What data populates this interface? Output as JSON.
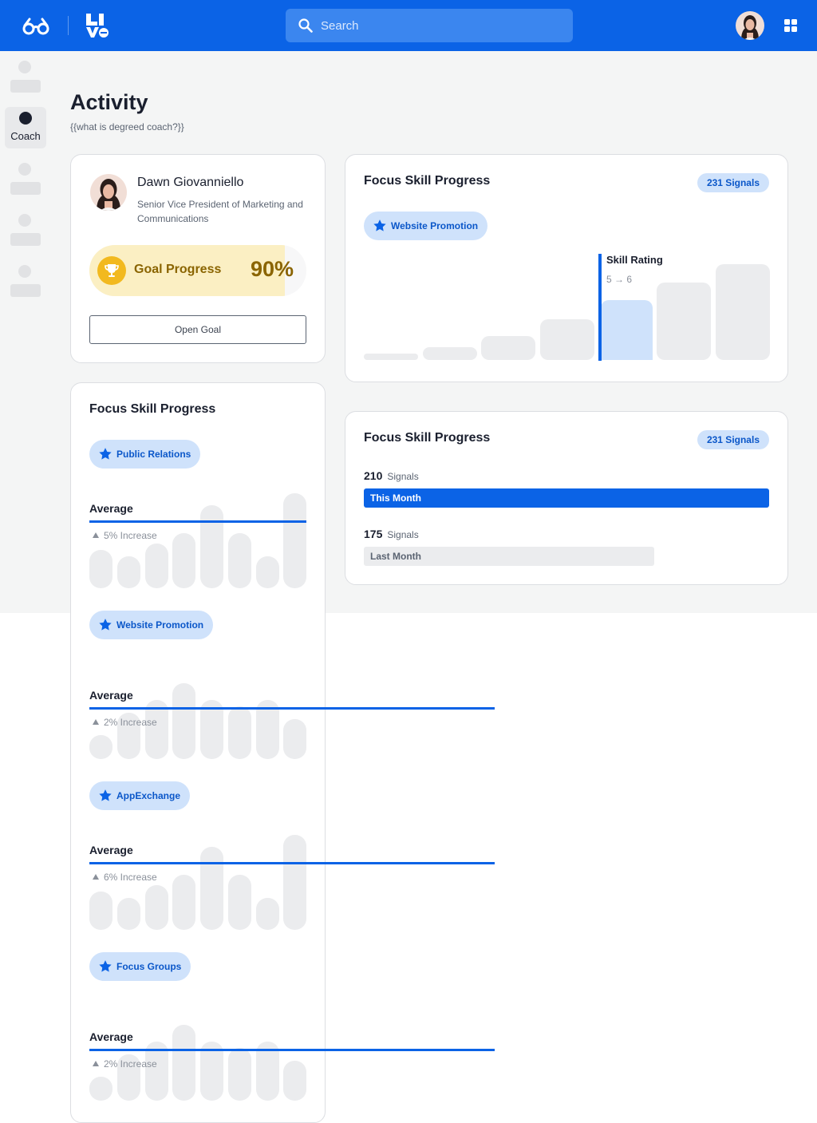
{
  "topbar": {
    "search_placeholder": "Search"
  },
  "sidebar": {
    "active_label": "Coach"
  },
  "page": {
    "title": "Activity",
    "subtitle": "{{what is degreed coach?}}"
  },
  "profile": {
    "name": "Dawn Giovanniello",
    "role": "Senior Vice President of Marketing and Communications",
    "goal_label": "Goal Progress",
    "goal_value": "90%",
    "goal_fraction": 0.9,
    "open_goal_label": "Open Goal"
  },
  "skill_card": {
    "title": "Focus Skill Progress",
    "badge": "231 Signals",
    "skill": "Website Promotion",
    "rating_label": "Skill Rating",
    "rating_value": "5 → 6"
  },
  "signals_card": {
    "title": "Focus Skill Progress",
    "badge": "231 Signals",
    "this_month_value": "210",
    "this_month_word": "Signals",
    "this_month_label": "This Month",
    "last_month_value": "175",
    "last_month_word": "Signals",
    "last_month_label": "Last Month"
  },
  "list_card": {
    "title": "Focus Skill Progress",
    "skills": [
      {
        "name": "Public Relations",
        "average_label": "Average",
        "increase": "5% Increase"
      },
      {
        "name": "Website Promotion",
        "average_label": "Average",
        "increase": "2% Increase"
      },
      {
        "name": "AppExchange",
        "average_label": "Average",
        "increase": "6% Increase"
      },
      {
        "name": "Focus Groups",
        "average_label": "Average",
        "increase": "2% Increase"
      }
    ]
  },
  "colors": {
    "brand": "#0b63e6",
    "badge_bg": "#cfe2fb",
    "goal_fill": "#fbefc3",
    "goal_text": "#8a6400",
    "trophy": "#f2b91f"
  },
  "icons": [
    "glasses-logo-icon",
    "lve-logo-icon",
    "search-icon",
    "apps-grid-icon",
    "star-icon",
    "trophy-icon",
    "increase-triangle-icon"
  ]
}
